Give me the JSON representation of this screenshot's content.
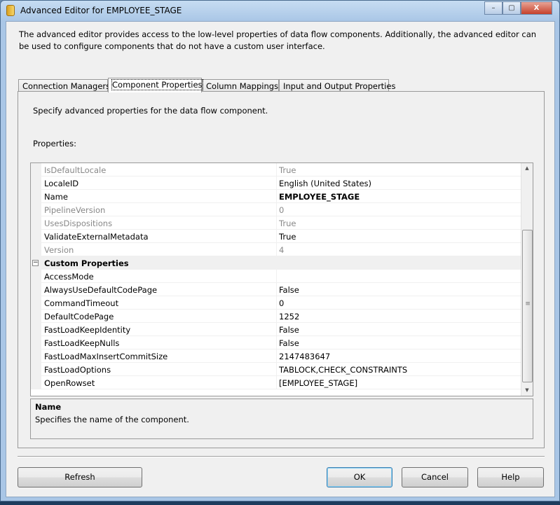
{
  "window": {
    "title": "Advanced Editor for EMPLOYEE_STAGE",
    "icon": "package-icon",
    "controls": {
      "minimize": "–",
      "maximize": "▢",
      "close": "X"
    }
  },
  "description": "The advanced editor provides access to the low-level properties of data flow components. Additionally, the advanced editor can be used to configure components that do not have a custom user interface.",
  "tabs": [
    {
      "label": "Connection Managers"
    },
    {
      "label": "Component Properties",
      "active": true
    },
    {
      "label": "Column Mappings"
    },
    {
      "label": "Input and Output Properties"
    }
  ],
  "panel": {
    "instruction": "Specify advanced properties for the data flow component.",
    "properties_label": "Properties:"
  },
  "properties": [
    {
      "name": "IsDefaultLocale",
      "value": "True",
      "readonly": true
    },
    {
      "name": "LocaleID",
      "value": "English (United States)"
    },
    {
      "name": "Name",
      "value": "EMPLOYEE_STAGE",
      "bold": true
    },
    {
      "name": "PipelineVersion",
      "value": "0",
      "readonly": true
    },
    {
      "name": "UsesDispositions",
      "value": "True",
      "readonly": true
    },
    {
      "name": "ValidateExternalMetadata",
      "value": "True"
    },
    {
      "name": "Version",
      "value": "4",
      "readonly": true
    },
    {
      "name": "Custom Properties",
      "category": true,
      "toggle": "−"
    },
    {
      "name": "AccessMode",
      "value": ""
    },
    {
      "name": "AlwaysUseDefaultCodePage",
      "value": "False"
    },
    {
      "name": "CommandTimeout",
      "value": "0"
    },
    {
      "name": "DefaultCodePage",
      "value": "1252"
    },
    {
      "name": "FastLoadKeepIdentity",
      "value": "False"
    },
    {
      "name": "FastLoadKeepNulls",
      "value": "False"
    },
    {
      "name": "FastLoadMaxInsertCommitSize",
      "value": "2147483647"
    },
    {
      "name": "FastLoadOptions",
      "value": "TABLOCK,CHECK_CONSTRAINTS"
    },
    {
      "name": "OpenRowset",
      "value": "[EMPLOYEE_STAGE]"
    }
  ],
  "scrollbar": {
    "up": "▲",
    "down": "▼",
    "grip": "≡"
  },
  "help": {
    "title": "Name",
    "text": "Specifies the name of the component."
  },
  "buttons": {
    "refresh": "Refresh",
    "ok": "OK",
    "cancel": "Cancel",
    "help": "Help"
  }
}
